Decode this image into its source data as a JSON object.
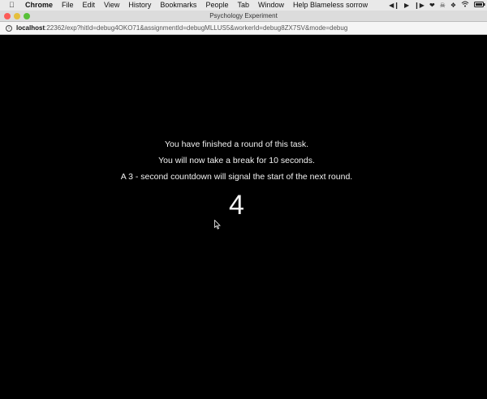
{
  "menubar": {
    "app": "Chrome",
    "items": [
      "File",
      "Edit",
      "View",
      "History",
      "Bookmarks",
      "People",
      "Tab",
      "Window",
      "Help"
    ],
    "now_playing": "Blameless sorrow"
  },
  "window": {
    "title": "Psychology Experiment"
  },
  "address": {
    "host": "localhost",
    "path": ":22362/exp?hitId=debug4OKO71&assignmentId=debugMLLUS5&workerId=debug8ZX7SV&mode=debug"
  },
  "experiment": {
    "line1": "You have finished a round of this task.",
    "line2": "You will now take a break for 10 seconds.",
    "line3": "A 3 - second countdown will signal the start of the next round.",
    "countdown": "4"
  },
  "icons": {
    "apple": "apple-icon",
    "prev": "previous-track-icon",
    "play": "play-icon",
    "next": "next-track-icon",
    "heart": "heart-icon",
    "skull": "skull-icon",
    "dropbox": "dropbox-icon",
    "wifi": "wifi-icon",
    "battery": "battery-icon"
  }
}
